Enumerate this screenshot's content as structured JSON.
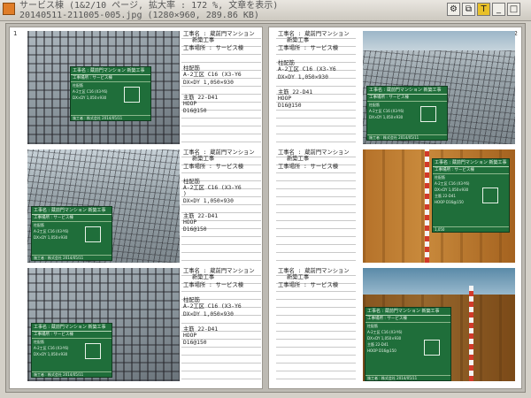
{
  "window": {
    "title_line1": "サービス棟 (1&2/10 ページ, 拡大率 : 172 %, 文章を表示)",
    "title_line2": "20140511-211005-005.jpg (1280×960, 289.86 KB)",
    "controls": [
      "⚙",
      "⧉",
      "T",
      "_",
      "□",
      "×"
    ],
    "accent": "#e07d28"
  },
  "pages": [
    {
      "number": "1"
    },
    {
      "number": "2"
    }
  ],
  "entries": [
    {
      "koji": "工事名 : 蔵前門マンション",
      "koji2": "新築工事",
      "basho": "工事場所 : サービス棟",
      "item1": "柱配筋",
      "item2": "A-2工区  C16 (X3-Y6",
      "item3": "DX×DY  1,050×930",
      "item4": "主筋  22-D41",
      "item5": "HOOP",
      "item6": "D16@150"
    },
    {
      "koji": "工事名 : 蔵前門マンション",
      "koji2": "新築工事",
      "basho": "工事場所 : サービス棟",
      "item1": "柱配筋",
      "item2": "A-2工区  C16 (X3-Y6",
      "item3": "DX×DY  1,050×930",
      "item4": "主筋  22-D41",
      "item5": "HOOP",
      "item6": "D16@150"
    },
    {
      "koji": "工事名 : 蔵前門マンション",
      "koji2": "新築工事",
      "basho": "工事場所 : サービス棟",
      "item1": "柱配筋",
      "item2": "A-2工区  C16 (X3-Y6",
      "item2b": ")",
      "item3": "DX×DY  1,050×930",
      "item4": "主筋  22-D41",
      "item5": "HOOP",
      "item6": "D16@150"
    },
    {
      "koji": "工事名 : 蔵前門マンション",
      "koji2": "新築工事",
      "basho": "工事場所 : サービス棟"
    },
    {
      "koji": "工事名 : 蔵前門マンション",
      "koji2": "新築工事",
      "basho": "工事場所 : サービス棟",
      "item1": "柱配筋",
      "item2": "A-2工区  C16 (X3-Y6",
      "item3": "DX×DY  1,050×930",
      "item4": "主筋  22-D41",
      "item5": "HOOP",
      "item6": "D16@150"
    },
    {
      "koji": "工事名 : 蔵前門マンション",
      "koji2": "新築工事",
      "basho": "工事場所 : サービス棟"
    }
  ],
  "board": {
    "header": "工事名 : 蔵前門マンション 新築工事",
    "sub": "工事場所 : サービス棟",
    "l1": "柱配筋",
    "l2": "A-2工区 C16 (X3-Y6)",
    "l3": "DX×DY 1,050×930",
    "l4": "主筋 22-D41",
    "l5": "HOOP D16@150",
    "dim": "1,050",
    "footer": "施工者 : 株式会社  2014/05/11"
  }
}
